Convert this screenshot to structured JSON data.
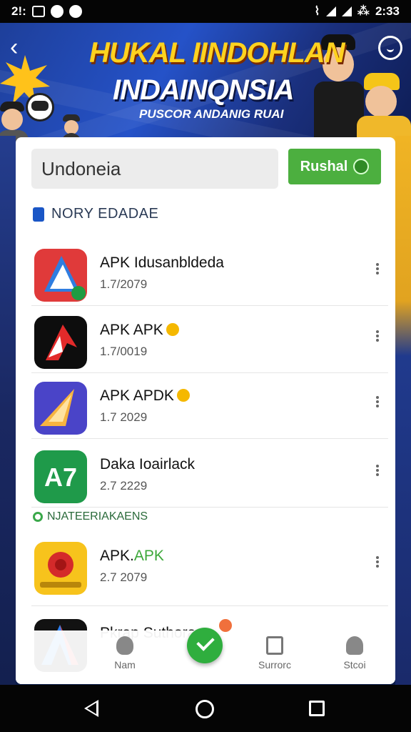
{
  "status_bar": {
    "time_left": "2!:",
    "time_right": "2:33",
    "right_mark": "⁂"
  },
  "banner": {
    "title": "HUKAL IINDOHLAN",
    "subtitle": "INDAINQNSIA",
    "tagline": "PUSCOR ANDANIG RUAI"
  },
  "search": {
    "value": "Undoneia",
    "button_label": "Rushal"
  },
  "section_title": "NORY EDADAE",
  "apps": [
    {
      "name": "APK Idusanbldeda",
      "version": "1.7/2079"
    },
    {
      "name": "APK APK",
      "version": "1.7/0019",
      "has_bulb": true
    },
    {
      "name": "APK APDK",
      "version": "1.7 2029",
      "has_bulb": true
    },
    {
      "name": "Daka Ioairlack",
      "version": "2.7 2229"
    }
  ],
  "section2_title": "NJATEERIAKAENS",
  "apps2": [
    {
      "name_prefix": "APK.",
      "name_suffix": "APK",
      "version": "2.7 2079"
    },
    {
      "name": "Pkrap Suthora"
    }
  ],
  "bottom_nav": {
    "item1": "Nam",
    "item2": "Surrorc",
    "item3": "Stcoi"
  },
  "colors": {
    "accent_green": "#4caf3f",
    "banner_blue": "#2552c8",
    "title_yellow": "#ffd21f"
  }
}
